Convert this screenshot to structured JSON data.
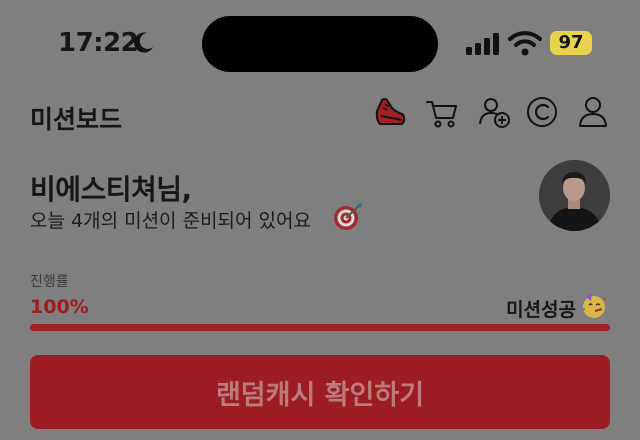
{
  "status_bar": {
    "time": "17:22",
    "battery": "97",
    "icons": [
      "moon-icon",
      "signal-icon",
      "wifi-icon",
      "battery-icon"
    ]
  },
  "header": {
    "title": "미션보드",
    "icons": [
      "shoe-icon",
      "cart-icon",
      "add-friend-icon",
      "cash-icon",
      "profile-icon"
    ]
  },
  "greeting": {
    "name": "비에스티쳐님,",
    "subtitle": "오늘 4개의 미션이 준비되어 있어요",
    "emoji_icon": "target-icon"
  },
  "progress": {
    "label": "진행률",
    "value_text": "100%",
    "percent": 100,
    "status": "미션성공",
    "status_icon": "party-face-icon"
  },
  "cta": {
    "label": "랜덤캐시 확인하기"
  },
  "colors": {
    "accent": "#9b1d21",
    "progress_text": "#9e1c20",
    "battery_badge": "#e8d34f",
    "overlay_background": "#7f7f7f"
  }
}
